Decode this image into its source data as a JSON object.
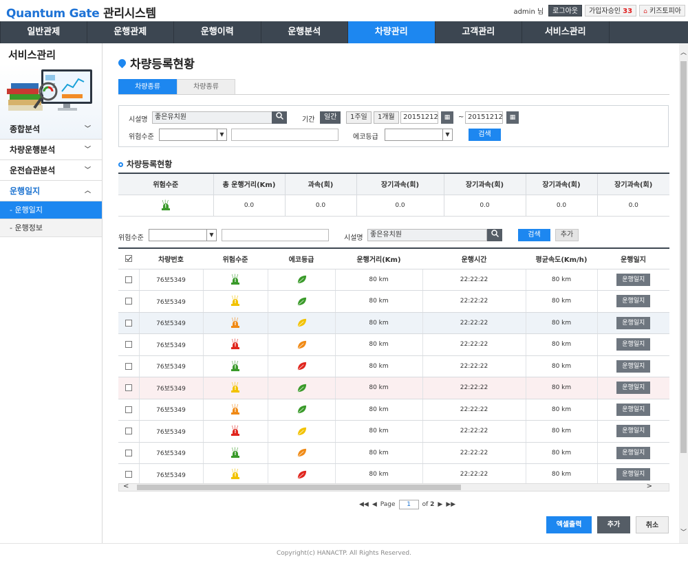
{
  "header": {
    "logo_brand": "Quantum",
    "logo_gate": "Gate",
    "logo_sys": "관리시스템",
    "user_label": "admin 님",
    "logout_label": "로그아웃",
    "signup_label": "가입자승인",
    "signup_count": "33",
    "kids_label": "키즈토피아"
  },
  "gnb": [
    "일반관제",
    "운행관제",
    "운행이력",
    "운행분석",
    "차량관리",
    "고객관리",
    "서비스관리"
  ],
  "gnb_active": 4,
  "sidebar": {
    "title": "서비스관리",
    "menus": [
      "종합분석",
      "차량운행분석",
      "운전습관분석",
      "운행일지"
    ],
    "subs": [
      "운행일지",
      "운행정보"
    ]
  },
  "page": {
    "title": "차량등록현황",
    "tabs": [
      "차량종류",
      "차량종류"
    ]
  },
  "search": {
    "facility_label": "시설명",
    "facility_value": "좋은유치원",
    "period_label": "기간",
    "period_btns": [
      "일간",
      "1주일",
      "1개월"
    ],
    "date_from": "20151212",
    "tilde": "~",
    "date_to": "20151212",
    "risk_label": "위험수준",
    "eco_label": "에코등급",
    "search_label": "검색"
  },
  "stats": {
    "section_title": "차량등록현황",
    "headers": [
      "위험수준",
      "총 운행거리(Km)",
      "과속(회)",
      "장기과속(회)",
      "장기과속(회)",
      "장기과속(회)",
      "장기과속(회)"
    ],
    "values": [
      "0.0",
      "0.0",
      "0.0",
      "0.0",
      "0.0",
      "0.0"
    ]
  },
  "filter2": {
    "risk_label": "위험수준",
    "facility_label": "시설명",
    "facility_value": "좋은유치원",
    "search_label": "검색",
    "add_label": "추가"
  },
  "list": {
    "headers": [
      "차량번호",
      "위험수준",
      "에코등급",
      "운행거리(Km)",
      "운행시간",
      "평균속도(Km/h)",
      "운행일지"
    ],
    "rows": [
      {
        "plate": "76보5349",
        "risk": "green",
        "eco": "green",
        "dist": "80 km",
        "time": "22:22:22",
        "speed": "80 km",
        "btn": "운행일지"
      },
      {
        "plate": "76보5349",
        "risk": "yellow",
        "eco": "green",
        "dist": "80 km",
        "time": "22:22:22",
        "speed": "80 km",
        "btn": "운행일지"
      },
      {
        "plate": "76보5349",
        "risk": "orange",
        "eco": "yellow",
        "dist": "80 km",
        "time": "22:22:22",
        "speed": "80 km",
        "btn": "운행일지"
      },
      {
        "plate": "76보5349",
        "risk": "red",
        "eco": "orange",
        "dist": "80 km",
        "time": "22:22:22",
        "speed": "80 km",
        "btn": "운행일지"
      },
      {
        "plate": "76보5349",
        "risk": "green",
        "eco": "red",
        "dist": "80 km",
        "time": "22:22:22",
        "speed": "80 km",
        "btn": "운행일지"
      },
      {
        "plate": "76보5349",
        "risk": "yellow",
        "eco": "green",
        "dist": "80 km",
        "time": "22:22:22",
        "speed": "80 km",
        "btn": "운행일지"
      },
      {
        "plate": "76보5349",
        "risk": "orange",
        "eco": "green",
        "dist": "80 km",
        "time": "22:22:22",
        "speed": "80 km",
        "btn": "운행일지"
      },
      {
        "plate": "76보5349",
        "risk": "red",
        "eco": "yellow",
        "dist": "80 km",
        "time": "22:22:22",
        "speed": "80 km",
        "btn": "운행일지"
      },
      {
        "plate": "76보5349",
        "risk": "green",
        "eco": "orange",
        "dist": "80 km",
        "time": "22:22:22",
        "speed": "80 km",
        "btn": "운행일지"
      },
      {
        "plate": "76보5349",
        "risk": "yellow",
        "eco": "red",
        "dist": "80 km",
        "time": "22:22:22",
        "speed": "80 km",
        "btn": "운행일지"
      }
    ]
  },
  "pager": {
    "page_label": "Page",
    "page": "1",
    "of_label": "of",
    "total": "2"
  },
  "actions": {
    "excel": "엑셀출력",
    "add": "추가",
    "cancel": "취소"
  },
  "footer": "Copyright(c) HANACTP. All Rights Reserved.",
  "colors": {
    "accent": "#1d87f0",
    "nav": "#3c4651",
    "green": "#3a9a2a",
    "yellow": "#f2c200",
    "orange": "#f08a16",
    "red": "#e0261e"
  }
}
